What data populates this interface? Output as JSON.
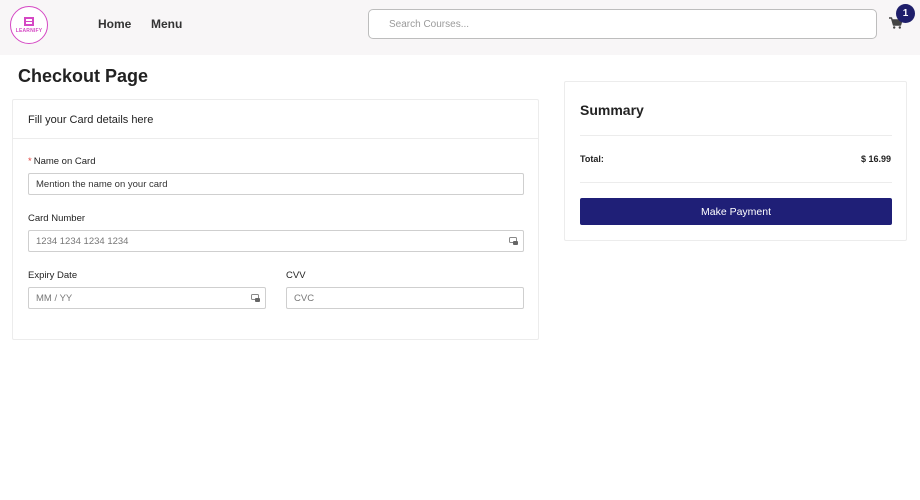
{
  "header": {
    "logo_text": "LEARNIFY",
    "nav": [
      {
        "label": "Home"
      },
      {
        "label": "Menu"
      }
    ],
    "search": {
      "placeholder": "Search Courses...",
      "value": ""
    },
    "cart": {
      "icon": "shopping-cart-icon",
      "count": "1"
    }
  },
  "page": {
    "title": "Checkout Page"
  },
  "card_form": {
    "heading": "Fill your Card details here",
    "name": {
      "required_mark": "*",
      "label": "Name on Card",
      "placeholder": "Mention the name on your card"
    },
    "number": {
      "label": "Card Number",
      "placeholder": "1234 1234 1234 1234"
    },
    "expiry": {
      "label": "Expiry Date",
      "placeholder": "MM / YY"
    },
    "cvv": {
      "label": "CVV",
      "placeholder": "CVC"
    }
  },
  "summary": {
    "title": "Summary",
    "total_label": "Total:",
    "total_value": "$ 16.99",
    "pay_label": "Make Payment"
  },
  "colors": {
    "accent": "#1f1f77",
    "badge": "#1f1f6b",
    "logo": "#d548c4",
    "required": "#e0413c"
  }
}
